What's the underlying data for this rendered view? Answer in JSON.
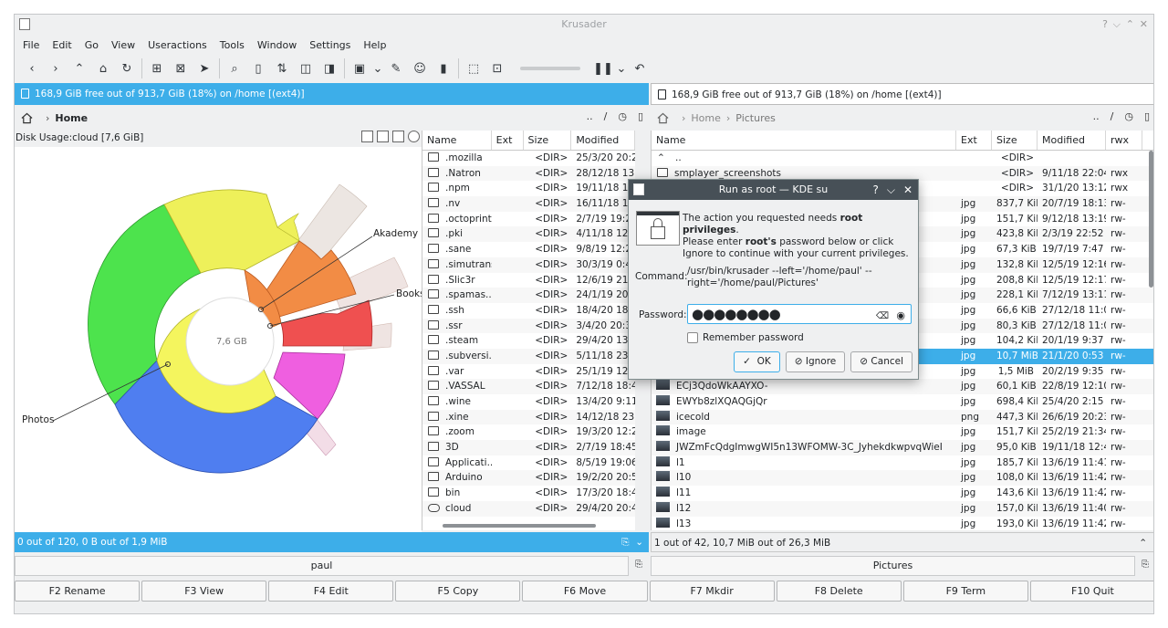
{
  "window": {
    "title": "Krusader",
    "controls": [
      "?",
      "⌵",
      "⌃",
      "✕"
    ]
  },
  "menu": [
    "File",
    "Edit",
    "Go",
    "View",
    "Useractions",
    "Tools",
    "Window",
    "Settings",
    "Help"
  ],
  "left": {
    "free": "168,9 GiB free out of 913,7 GiB (18%) on /home [(ext4)]",
    "crumb": {
      "current": "Home",
      "actions": [
        "..",
        "/"
      ]
    },
    "disk_usage": "Disk Usage:cloud  [7,6 GiB]",
    "center_label": "7,6 GB",
    "chart_labels": [
      "Akademy",
      "Books",
      "Photos"
    ],
    "columns": [
      "Name",
      "Ext",
      "Size",
      "Modified"
    ],
    "rows": [
      [
        ".mozilla",
        "",
        "<DIR>",
        "25/3/20 20:22"
      ],
      [
        ".Natron",
        "",
        "<DIR>",
        "28/12/18 13:38"
      ],
      [
        ".npm",
        "",
        "<DIR>",
        "19/11/18 13:49"
      ],
      [
        ".nv",
        "",
        "<DIR>",
        "16/11/18 12:37"
      ],
      [
        ".octoprint",
        "",
        "<DIR>",
        "2/7/19 19:26"
      ],
      [
        ".pki",
        "",
        "<DIR>",
        "4/11/18 12:44"
      ],
      [
        ".sane",
        "",
        "<DIR>",
        "9/8/19 12:29"
      ],
      [
        ".simutrans",
        "",
        "<DIR>",
        "30/3/19 0:47"
      ],
      [
        ".Slic3r",
        "",
        "<DIR>",
        "12/6/19 21:10"
      ],
      [
        ".spamas...",
        "",
        "<DIR>",
        "24/1/19 20:05"
      ],
      [
        ".ssh",
        "",
        "<DIR>",
        "18/4/20 18:26"
      ],
      [
        ".ssr",
        "",
        "<DIR>",
        "3/4/20 20:37"
      ],
      [
        ".steam",
        "",
        "<DIR>",
        "29/4/20 13:06"
      ],
      [
        ".subversi...",
        "",
        "<DIR>",
        "5/11/18 23:53"
      ],
      [
        ".var",
        "",
        "<DIR>",
        "25/1/19 12:51"
      ],
      [
        ".VASSAL",
        "",
        "<DIR>",
        "7/12/18 18:43"
      ],
      [
        ".wine",
        "",
        "<DIR>",
        "13/4/20 9:11"
      ],
      [
        ".xine",
        "",
        "<DIR>",
        "14/12/18 23:35"
      ],
      [
        ".zoom",
        "",
        "<DIR>",
        "19/3/20 12:20"
      ],
      [
        "3D",
        "",
        "<DIR>",
        "2/7/19 18:45"
      ],
      [
        "Applicati...",
        "",
        "<DIR>",
        "8/5/19 19:06"
      ],
      [
        "Arduino",
        "",
        "<DIR>",
        "19/2/20 20:50"
      ],
      [
        "bin",
        "",
        "<DIR>",
        "17/3/20 18:49"
      ],
      [
        "cloud",
        "",
        "<DIR>",
        "29/4/20 20:47"
      ]
    ],
    "status": "0 out of 120, 0 B out of 1,9 MiB",
    "cmd_label": "paul"
  },
  "right": {
    "free": "168,9 GiB free out of 913,7 GiB (18%) on /home [(ext4)]",
    "crumb": {
      "parent": "Home",
      "current": "Pictures",
      "actions": [
        "..",
        "/"
      ]
    },
    "columns": [
      "Name",
      "Ext",
      "Size",
      "Modified",
      "rwx"
    ],
    "rows": [
      [
        "..",
        "",
        "<DIR>",
        "",
        ""
      ],
      [
        "smplayer_screenshots",
        "",
        "<DIR>",
        "9/11/18 22:04",
        "rwx"
      ],
      [
        "",
        "",
        "<DIR>",
        "31/1/20 13:12",
        "rwx"
      ],
      [
        "",
        "jpg",
        "837,7 KiB",
        "20/7/19 18:13",
        "rw-"
      ],
      [
        "",
        "jpg",
        "151,7 KiB",
        "9/12/18 13:19",
        "rw-"
      ],
      [
        "",
        "jpg",
        "423,8 KiB",
        "2/3/19 22:52",
        "rw-"
      ],
      [
        "",
        "jpg",
        "67,3 KiB",
        "19/7/19 7:47",
        "rw-"
      ],
      [
        "",
        "jpg",
        "132,8 KiB",
        "12/5/19 12:16",
        "rw-"
      ],
      [
        "",
        "jpg",
        "208,8 KiB",
        "12/5/19 12:17",
        "rw-"
      ],
      [
        "",
        "jpg",
        "228,1 KiB",
        "7/12/19 13:11",
        "rw-"
      ],
      [
        "",
        "jpg",
        "66,6 KiB",
        "27/12/18 11:05",
        "rw-"
      ],
      [
        "",
        "jpg",
        "80,3 KiB",
        "27/12/18 11:06",
        "rw-"
      ],
      [
        "",
        "jpg",
        "104,2 KiB",
        "20/1/19 9:37",
        "rw-"
      ],
      [
        "",
        "jpg",
        "10,7 MiB",
        "21/1/20 0:53",
        "rw-"
      ],
      [
        "",
        "jpg",
        "1,5 MiB",
        "20/2/19 9:35",
        "rw-"
      ],
      [
        "ECj3QdoWkAAYXO-",
        "jpg",
        "60,1 KiB",
        "22/8/19 12:10",
        "rw-"
      ],
      [
        "EWYb8zlXQAQGjQr",
        "jpg",
        "698,4 KiB",
        "25/4/20 2:15",
        "rw-"
      ],
      [
        "icecold",
        "png",
        "447,3 KiB",
        "26/6/19 20:23",
        "rw-"
      ],
      [
        "image",
        "jpg",
        "151,7 KiB",
        "25/2/19 21:34",
        "rw-"
      ],
      [
        "JWZmFcQdgImwgWI5n13WFOMW-3C_Jyhekdkwpvq​WieI",
        "jpg",
        "95,0 KiB",
        "19/11/18 12:46",
        "rw-"
      ],
      [
        "l1",
        "jpg",
        "185,7 KiB",
        "13/6/19 11:41",
        "rw-"
      ],
      [
        "l10",
        "jpg",
        "108,0 KiB",
        "13/6/19 11:42",
        "rw-"
      ],
      [
        "l11",
        "jpg",
        "143,6 KiB",
        "13/6/19 11:42",
        "rw-"
      ],
      [
        "l12",
        "jpg",
        "157,0 KiB",
        "13/6/19 11:40",
        "rw-"
      ],
      [
        "l13",
        "jpg",
        "193,0 KiB",
        "13/6/19 11:42",
        "rw-"
      ]
    ],
    "status": "1 out of 42, 10,7 MiB out of 26,3 MiB",
    "cmd_label": "Pictures"
  },
  "fkeys": [
    "F2 Rename",
    "F3 View",
    "F4 Edit",
    "F5 Copy",
    "F6 Move",
    "F7 Mkdir",
    "F8 Delete",
    "F9 Term",
    "F10 Quit"
  ],
  "dialog": {
    "title": "Run as root — KDE su",
    "controls": [
      "?",
      "⌵",
      "✕"
    ],
    "msg_pre": "The action you requested needs ",
    "msg_bold": "root privileges",
    "msg_post": ".",
    "msg2_pre": "Please enter ",
    "msg2_bold": "root's",
    "msg2_post": " password below or click Ignore to continue with your current privileges.",
    "command_label": "Command:",
    "command": "/usr/bin/krusader --left='/home/paul' --right='/home/paul/Pictures'",
    "password_label": "Password:",
    "password_mask": "●●●●●●●●",
    "remember": "Remember password",
    "ok": "OK",
    "ignore": "Ignore",
    "cancel": "Cancel"
  }
}
